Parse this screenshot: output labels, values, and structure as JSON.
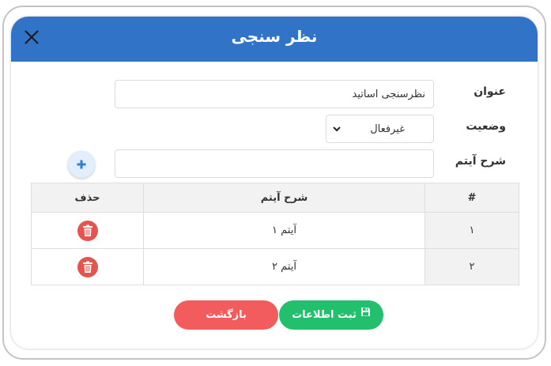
{
  "dialog": {
    "title": "نظر سنجی",
    "close_icon": "close-icon",
    "header_color": "#3173c6"
  },
  "form": {
    "title_label": "عنوان",
    "title_value": "نظرسنجی اساتید",
    "status_label": "وضعیت",
    "status_value": "غیرفعال",
    "item_label": "شرح آیتم",
    "item_value": "",
    "add_icon": "plus-icon"
  },
  "table": {
    "headers": {
      "number": "#",
      "description": "شرح آیتم",
      "delete": "حذف"
    },
    "rows": [
      {
        "number": "۱",
        "description": "آیتم ۱",
        "delete_icon": "trash-icon"
      },
      {
        "number": "۲",
        "description": "آیتم ۲",
        "delete_icon": "trash-icon"
      }
    ]
  },
  "footer": {
    "save_label": "ثبت اطلاعات",
    "save_icon": "save-icon",
    "save_color": "#22bf6c",
    "back_label": "بازگشت",
    "back_color": "#f25c5c"
  }
}
